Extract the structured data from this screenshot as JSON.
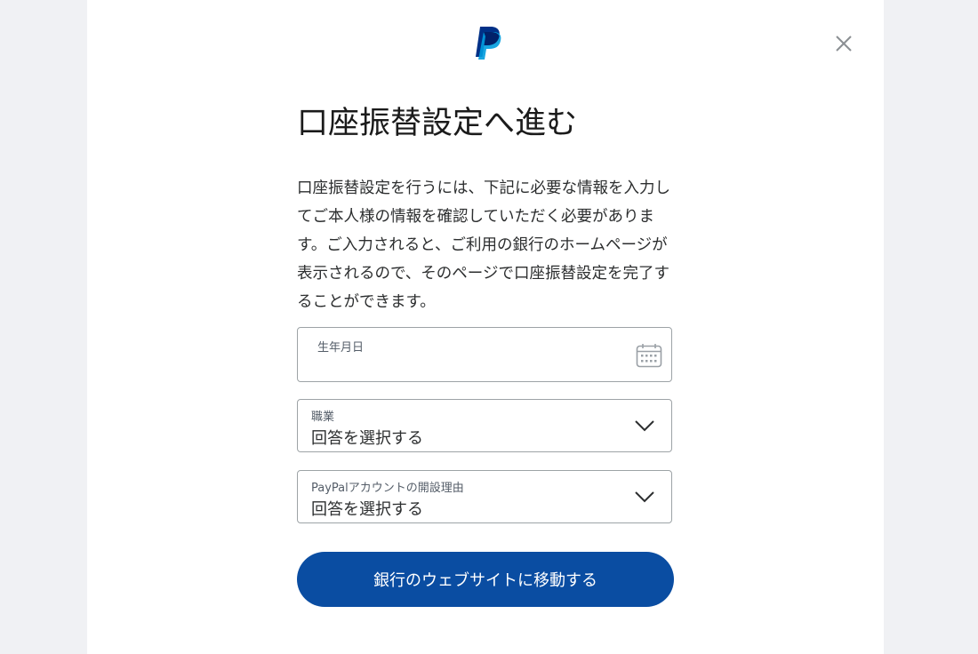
{
  "dialog": {
    "title": "口座振替設定へ進む",
    "description": "口座振替設定を行うには、下記に必要な情報を入力してご本人様の情報を確認していただく必要があります。ご入力されると、ご利用の銀行のホームページが表示されるので、そのページで口座振替設定を完了することができます。",
    "brand_colors": {
      "dark": "#003087",
      "light": "#009cde",
      "button": "#0a4da2"
    }
  },
  "form": {
    "birthdate": {
      "label": "生年月日",
      "value": "",
      "icon": "calendar-icon"
    },
    "occupation": {
      "label": "職業",
      "value": "回答を選択する",
      "icon": "chevron-down-icon"
    },
    "reason": {
      "label": "PayPalアカウントの開設理由",
      "value": "回答を選択する",
      "icon": "chevron-down-icon"
    }
  },
  "actions": {
    "submit_label": "銀行のウェブサイトに移動する",
    "close_icon": "close-icon"
  }
}
